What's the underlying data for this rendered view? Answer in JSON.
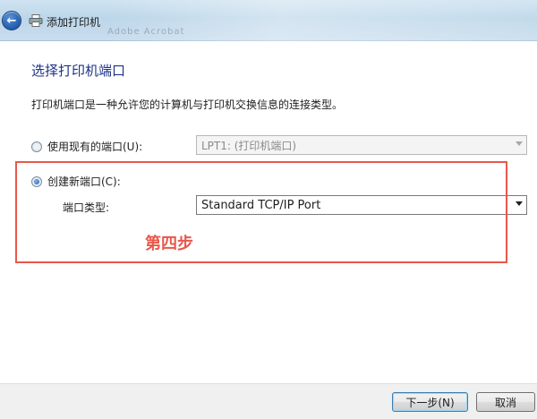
{
  "window": {
    "title": "添加打印机",
    "background_text": "Adobe Acrobat"
  },
  "page": {
    "heading": "选择打印机端口",
    "description": "打印机端口是一种允许您的计算机与打印机交换信息的连接类型。"
  },
  "options": {
    "use_existing": {
      "label": "使用现有的端口(U):",
      "selected": false,
      "dropdown_value": "LPT1: (打印机端口)"
    },
    "create_new": {
      "label": "创建新端口(C):",
      "selected": true,
      "port_type_label": "端口类型:",
      "dropdown_value": "Standard TCP/IP Port"
    }
  },
  "annotation": {
    "step_label": "第四步",
    "color": "#e8584b"
  },
  "buttons": {
    "next": "下一步(N)",
    "cancel": "取消"
  },
  "colors": {
    "heading": "#1e3287",
    "titlebar": "#bcd6e9"
  },
  "icons": {
    "back": "back-arrow-icon",
    "printer": "printer-icon",
    "dropdown": "chevron-down-icon"
  }
}
